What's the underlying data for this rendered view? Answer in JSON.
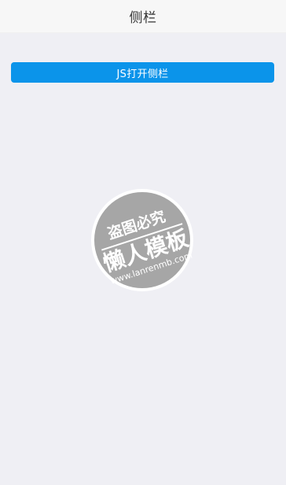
{
  "header": {
    "title": "侧栏"
  },
  "main": {
    "open_sidebar_button_label": "JS打开侧栏"
  },
  "watermark": {
    "top_text": "盗图必究",
    "middle_text": "懒人模板",
    "bottom_text": "www.lanrenmb.com"
  },
  "colors": {
    "page_background": "#efeff4",
    "header_background": "#f7f7f7",
    "button_background": "#0b94ea",
    "button_text": "#ffffff",
    "watermark_fill": "#a6a6a6"
  }
}
